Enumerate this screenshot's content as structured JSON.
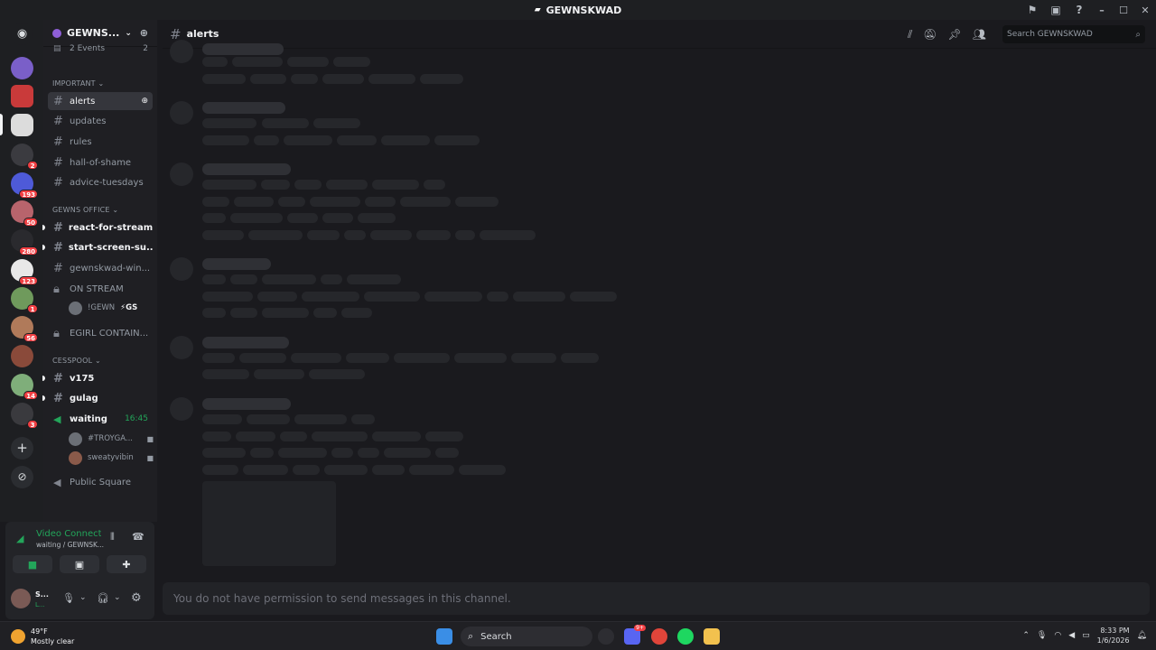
{
  "window": {
    "title": "GEWNSKWAD"
  },
  "server": {
    "name": "GEWNS...",
    "events_label": "2 Events",
    "events_count": "2"
  },
  "header": {
    "channel": "alerts",
    "search_placeholder": "Search GEWNSKWAD"
  },
  "guild_badges": [
    "2",
    "193",
    "50",
    "280",
    "123",
    "1",
    "56",
    "14",
    "3"
  ],
  "categories": {
    "important": "IMPORTANT",
    "office": "GEWNS OFFICE",
    "cesspool": "CESSPOOL"
  },
  "channels": {
    "alerts": "alerts",
    "updates": "updates",
    "rules": "rules",
    "hall": "hall-of-shame",
    "advice": "advice-tuesdays",
    "react": "react-for-stream",
    "start": "start-screen-su...",
    "gewnskwad": "gewnskwad-win...",
    "onstream": "ON STREAM",
    "onstream_user": "!GEWN",
    "onstream_tag": "⚡GS",
    "egirl": "EGIRL CONTAIN...",
    "v175": "v175",
    "gulag": "gulag",
    "waiting": "waiting",
    "waiting_time": "16:45",
    "waiting_user1": "#TROYGA...",
    "waiting_user2": "sweatyvibin",
    "public": "Public Square"
  },
  "voice": {
    "status": "Video Connecte",
    "location": "waiting / GEWNSK..."
  },
  "user": {
    "name": "S...",
    "status": "L..."
  },
  "composer": {
    "placeholder": "You do not have permission to send messages in this channel."
  },
  "taskbar": {
    "temp": "49°F",
    "weather": "Mostly clear",
    "search": "Search",
    "time": "8:33 PM",
    "date": "1/6/2026",
    "discord_badge": "9+"
  },
  "colors": {
    "accent_green": "#23a55a",
    "badge_red": "#f23f43",
    "background": "#1a1a1e"
  }
}
